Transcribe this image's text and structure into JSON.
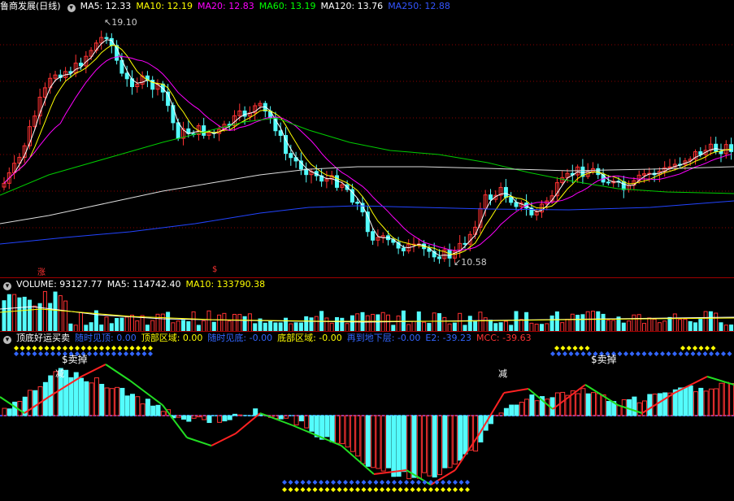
{
  "price": {
    "title": "鲁商发展(日线)",
    "ma": [
      {
        "label": "MA5: 12.33",
        "color": "#ffffff"
      },
      {
        "label": "MA10: 12.19",
        "color": "#ffff00"
      },
      {
        "label": "MA20: 12.83",
        "color": "#ff00ff"
      },
      {
        "label": "MA60: 13.19",
        "color": "#00ff00"
      },
      {
        "label": "MA120: 13.76",
        "color": "#ffffff"
      },
      {
        "label": "MA250: 12.88",
        "color": "#3355ff"
      }
    ],
    "high_label": "19.10",
    "low_label": "10.58",
    "marker_zhang": "涨",
    "marker_dollar": "$"
  },
  "volume": {
    "label": "VOLUME: 93127.77",
    "ma5": "MA5: 114742.40",
    "ma10": "MA10: 133790.38"
  },
  "indicator": {
    "title": "顶底好运买卖",
    "items": [
      {
        "label": "随时见顶: 0.00",
        "color": "#3366ff"
      },
      {
        "label": "顶部区域: 0.00",
        "color": "#ffff00"
      },
      {
        "label": "随时见底: -0.00",
        "color": "#3366ff"
      },
      {
        "label": "底部区域: -0.00",
        "color": "#ffff00"
      },
      {
        "label": "再到地下层: -0.00",
        "color": "#3366ff"
      },
      {
        "label": "E2: -39.23",
        "color": "#3366ff"
      },
      {
        "label": "MCC: -39.63",
        "color": "#ff3333"
      }
    ],
    "sell_label_1": "$卖掉",
    "sell_label_2": "$卖掉",
    "jian_1": "减",
    "jian_2": "减"
  },
  "colors": {
    "up": "#ff3232",
    "down": "#54fcfc",
    "grid": "#8b0000"
  }
}
